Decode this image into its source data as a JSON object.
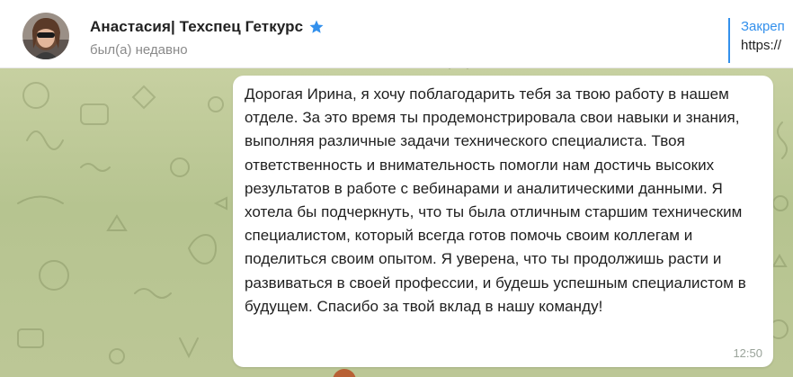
{
  "header": {
    "chat_name": "Анастасия| Техспец Геткурс",
    "status": "был(а) недавно",
    "verified_icon": "star-icon",
    "pinned_title": "Закреп",
    "pinned_text": "https://"
  },
  "message": {
    "text": "Дорогая Ирина, я хочу поблагодарить тебя за твою работу в нашем отделе. За это время ты продемонстрировала свои навыки и знания, выполняя различные задачи технического специалиста. Твоя ответственность и внимательность помогли нам достичь высоких результатов в работе с вебинарами и аналитическими данными. Я хотела бы подчеркнуть, что ты была отличным старшим техническим специалистом, который всегда готов помочь своим коллегам и поделиться своим опытом. Я уверена, что ты продолжишь расти и развиваться в своей профессии, и будешь успешным специалистом в будущем. Спасибо за твой вклад в нашу команду!",
    "time": "12:50"
  },
  "colors": {
    "accent": "#3390ec",
    "chat_background": "#bcc796",
    "bubble": "#ffffff"
  }
}
